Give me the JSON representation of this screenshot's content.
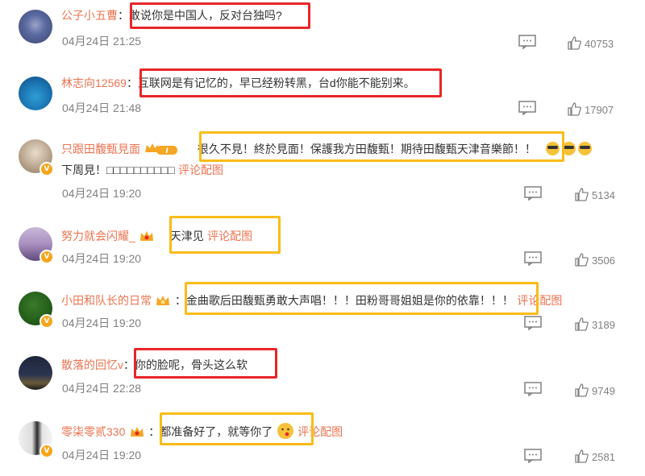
{
  "comments": [
    {
      "user": "公子小五曹",
      "text": "敢说你是中国人，反对台独吗?",
      "time": "04月24日 21:25",
      "likes": "40753"
    },
    {
      "user": "林志向12569",
      "text": "互联网是有记忆的，早已经粉转黑，台d你能不能别来。",
      "time": "04月24日 21:48",
      "likes": "17907"
    },
    {
      "user": "只跟田馥甄見面",
      "text": "很久不見！終於見面！保護我方田馥甄！期待田馥甄天津音樂節！！",
      "text2": "下周見！□□□□□□□□□□",
      "link": "评论配图",
      "badge": "I",
      "time": "04月24日 19:20",
      "likes": "5134"
    },
    {
      "user": "努力就会闪耀_",
      "text": "天津见",
      "link": "评论配图",
      "time": "04月24日 19:20",
      "likes": "3506"
    },
    {
      "user": "小田和队长的日常",
      "text": "金曲歌后田馥甄勇敢大声唱！！！田粉哥哥姐姐是你的依靠！！！",
      "link": "评论配图",
      "time": "04月24日 19:20",
      "likes": "3189"
    },
    {
      "user": "散落的回忆v",
      "text": "你的脸呢，骨头这么软",
      "time": "04月24日 22:28",
      "likes": "9749"
    },
    {
      "user": "零柒零贰330",
      "text": "都准备好了，就等你了",
      "link": "评论配图",
      "time": "04月24日 19:20",
      "likes": "2581"
    }
  ],
  "colors": {
    "username": "#eb7350",
    "red_box": "#e8262a",
    "yellow_box": "#f9bc17",
    "meta": "#808080"
  },
  "icons": {
    "comment": "comment-icon",
    "like": "thumbs-up-icon",
    "badge": "vip-crown-icon",
    "verified": "verified-badge-icon",
    "emoji": "sunglasses-emoji-icon"
  }
}
